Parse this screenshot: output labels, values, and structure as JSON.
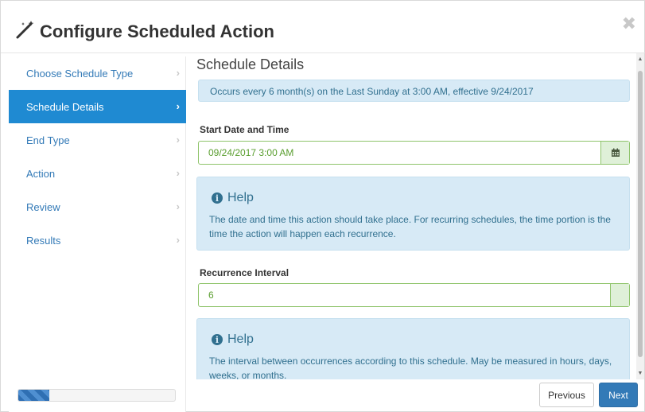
{
  "dialog": {
    "title": "Configure Scheduled Action",
    "close_glyph": "✖",
    "title_icon": "magic-wand-icon"
  },
  "sidebar": {
    "items": [
      {
        "label": "Choose Schedule Type",
        "active": false
      },
      {
        "label": "Schedule Details",
        "active": true
      },
      {
        "label": "End Type",
        "active": false
      },
      {
        "label": "Action",
        "active": false
      },
      {
        "label": "Review",
        "active": false
      },
      {
        "label": "Results",
        "active": false
      }
    ],
    "chevron": "›",
    "progress_fraction": 0.2
  },
  "content": {
    "section_title": "Schedule Details",
    "summary": "Occurs every 6 month(s) on the Last Sunday at 3:00 AM, effective 9/24/2017",
    "start": {
      "label": "Start Date and Time",
      "value": "09/24/2017 3:00 AM",
      "addon_icon": "calendar-icon"
    },
    "help1": {
      "heading": "Help",
      "text": "The date and time this action should take place. For recurring schedules, the time portion is the time the action will happen each recurrence."
    },
    "interval": {
      "label": "Recurrence Interval",
      "value": "6"
    },
    "help2": {
      "heading": "Help",
      "text": "The interval between occurrences according to this schedule. May be measured in hours, days, weeks, or months."
    }
  },
  "footer": {
    "previous_label": "Previous",
    "next_label": "Next"
  },
  "colors": {
    "accent": "#1f8ad2",
    "link": "#337ab7",
    "info_bg": "#d7eaf6",
    "info_text": "#31708f",
    "success_border": "#8fc46b"
  }
}
